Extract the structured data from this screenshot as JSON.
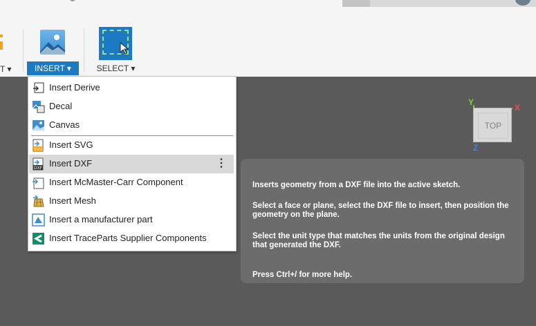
{
  "ribbon": {
    "partial_label": "T ▾",
    "insert_label": "INSERT ▾",
    "select_label": "SELECT ▾"
  },
  "menu": {
    "items": [
      {
        "label": "Insert Derive",
        "icon": "derive-icon"
      },
      {
        "label": "Decal",
        "icon": "decal-icon"
      },
      {
        "label": "Canvas",
        "icon": "canvas-icon"
      },
      {
        "label": "Insert SVG",
        "icon": "svg-icon"
      },
      {
        "label": "Insert DXF",
        "icon": "dxf-icon",
        "highlighted": true
      },
      {
        "label": "Insert McMaster-Carr Component",
        "icon": "mcmaster-icon"
      },
      {
        "label": "Insert Mesh",
        "icon": "mesh-icon"
      },
      {
        "label": "Insert a manufacturer part",
        "icon": "manufacturer-part-icon"
      },
      {
        "label": "Insert TraceParts Supplier Components",
        "icon": "traceparts-icon"
      }
    ]
  },
  "tooltip": {
    "line1": "Inserts geometry from a DXF file into the active sketch.",
    "line2": "Select a face or plane, select the DXF file to insert, then position the geometry on the plane.",
    "line3": "Select the unit type that matches the units from the original design that generated the DXF.",
    "line4": "Press Ctrl+/ for more help."
  },
  "viewcube": {
    "face": "TOP",
    "axis_x": "X",
    "axis_y": "Y",
    "axis_z": "Z"
  },
  "colors": {
    "accent": "#1c7ac2",
    "canvas": "#5a5a5a",
    "tooltip": "#6c6c6c"
  }
}
